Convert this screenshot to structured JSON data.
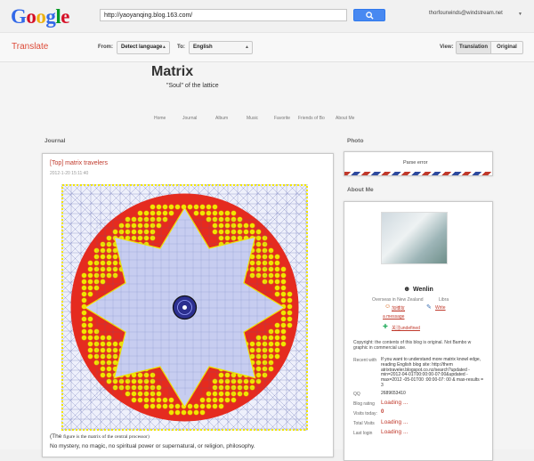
{
  "browser": {
    "logo_letters": [
      "G",
      "o",
      "o",
      "g",
      "l",
      "e"
    ],
    "url": "http://yaoyanqing.blog.163.com/",
    "account_email": "thorfourwinds@windstream.net"
  },
  "translate_bar": {
    "title": "Translate",
    "from_label": "From:",
    "from_value": "Detect language",
    "to_label": "To:",
    "to_value": "English",
    "view_label": "View:",
    "view_translation": "Translation",
    "view_original": "Original"
  },
  "blog": {
    "title": "Matrix",
    "subtitle": "\"Soul\" of the lattice",
    "nav": [
      "Home",
      "Journal",
      "Album",
      "Music",
      "Favorite",
      "Friends of Bo",
      "About Me"
    ]
  },
  "journal": {
    "heading": "Journal",
    "post_title": "[Top] matrix travelers",
    "post_date": "2012-1-20 15:11:40",
    "caption_open": "(The ",
    "caption_note": "figure is the matrix of the central processor)",
    "body_line": "No mystery, no magic, no spiritual power or supernatural, or religion, philosophy."
  },
  "photo": {
    "heading": "Photo",
    "status": "Parse error"
  },
  "about": {
    "heading": "About Me",
    "name": "Wenlin",
    "location": "Overseas in New Zealand",
    "sign": "Libra",
    "add_friend": "加博友",
    "write": "Write",
    "message": "a message",
    "undefined_link": "关注undefined",
    "copyright": "Copyright: the contents of this blog is original. Not Bambo w graphic in commercial use.",
    "rows": [
      {
        "key": "Recent with",
        "value": "If you want to understand more matrix knowl edge, reading English blog site: http://them atrixtraveler.blogspot.co.nz/search?updated -min=2012-04-01T00:00:00-07:00&updated -max=2012 -05-01T00 :00:00-07: 00 & max-results = 3"
      },
      {
        "key": "QQ",
        "value": "2689653410"
      },
      {
        "key": "Blog rating",
        "value": "Loading ..."
      },
      {
        "key": "Visits today:",
        "value": "0"
      },
      {
        "key": "Total Visits",
        "value": "Loading ..."
      },
      {
        "key": "Last login",
        "value": "Loading ..."
      }
    ]
  },
  "colors": {
    "google_blue": "#4889f1",
    "translate_red": "#dd4b39",
    "ring_red": "#e52b1f",
    "dot_yellow": "#f2e600",
    "lattice_blue": "#c7cdf0",
    "lattice_line": "#4a55a8",
    "core_navy": "#2c2f8f"
  }
}
